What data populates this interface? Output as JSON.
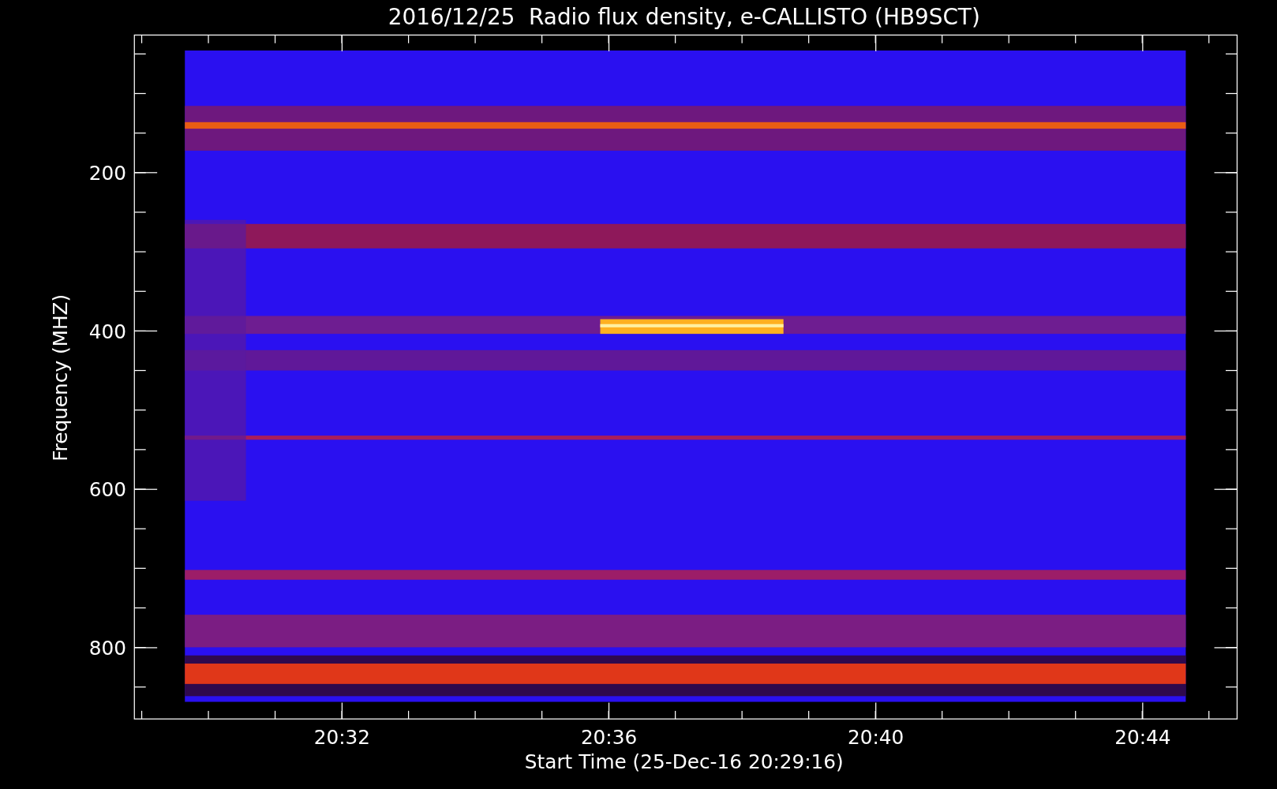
{
  "title": "2016/12/25  Radio flux density, e-CALLISTO (HB9SCT)",
  "plot": {
    "ylabel": "Frequency (MHZ)",
    "xlabel": "Start Time (25-Dec-16 20:29:16)",
    "yticks": [
      "200",
      "400",
      "600",
      "800"
    ],
    "xticks": [
      "20:32",
      "20:36",
      "20:40",
      "20:44"
    ]
  }
}
